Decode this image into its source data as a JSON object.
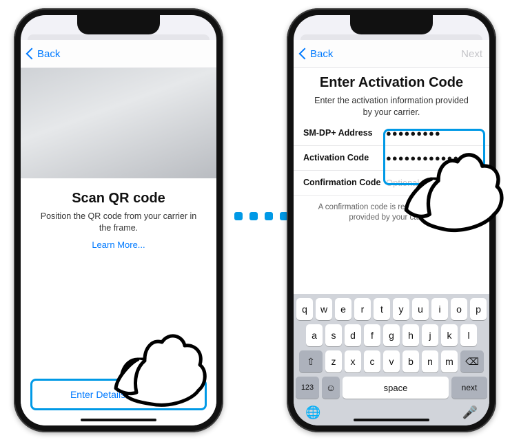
{
  "left": {
    "back_label": "Back",
    "title": "Scan QR code",
    "subtitle": "Position the QR code from your carrier in the frame.",
    "learn_more": "Learn More...",
    "manual_button": "Enter Details Manually"
  },
  "right": {
    "back_label": "Back",
    "next_label": "Next",
    "title": "Enter Activation Code",
    "subtitle": "Enter the activation information provided by your carrier.",
    "fields": {
      "smdp_label": "SM-DP+ Address",
      "smdp_value": "●●●●●●●●●",
      "activation_label": "Activation Code",
      "activation_value": "●●●●●●●●●●●●●",
      "confirmation_label": "Confirmation Code",
      "confirmation_placeholder": "Optional"
    },
    "hint": "A confirmation code is required if one was provided by your carrier."
  },
  "keyboard": {
    "row1": [
      "q",
      "w",
      "e",
      "r",
      "t",
      "y",
      "u",
      "i",
      "o",
      "p"
    ],
    "row2": [
      "a",
      "s",
      "d",
      "f",
      "g",
      "h",
      "j",
      "k",
      "l"
    ],
    "row3": [
      "z",
      "x",
      "c",
      "v",
      "b",
      "n",
      "m"
    ],
    "shift": "⇧",
    "backspace": "⌫",
    "num": "123",
    "emoji": "☺",
    "space": "space",
    "next": "next",
    "globe": "🌐",
    "mic": "🎤"
  }
}
